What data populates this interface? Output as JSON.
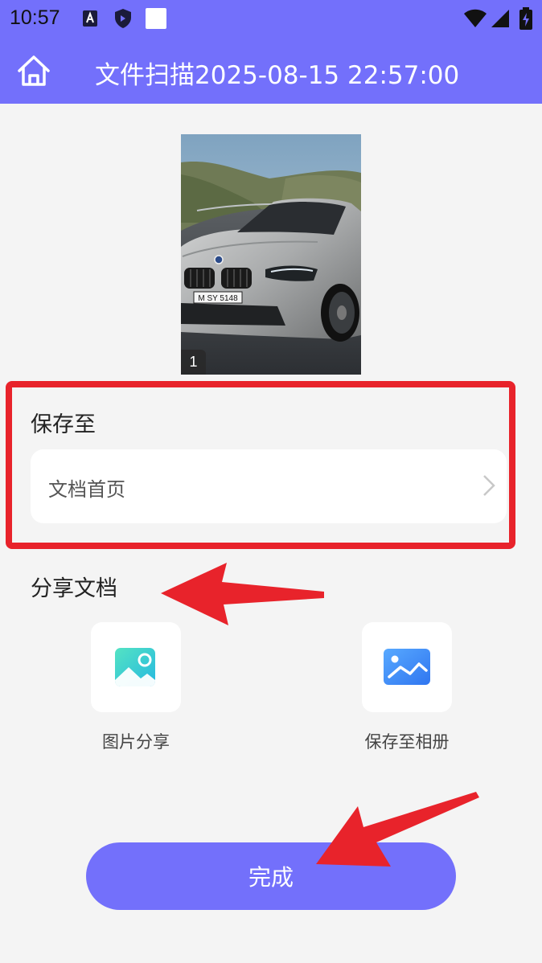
{
  "status_bar": {
    "time": "10:57"
  },
  "app_bar": {
    "title": "文件扫描2025-08-15 22:57:00"
  },
  "preview": {
    "page_number": "1",
    "plate": "M SY 5148"
  },
  "save_section": {
    "title": "保存至",
    "destination": "文档首页"
  },
  "share_section": {
    "title": "分享文档",
    "options": [
      {
        "label": "图片分享",
        "icon": "image-share-icon"
      },
      {
        "label": "保存至相册",
        "icon": "gallery-icon"
      }
    ]
  },
  "done_button": {
    "label": "完成"
  },
  "colors": {
    "primary": "#7370fb",
    "annotation_red": "#e8232b",
    "background": "#f4f4f4"
  }
}
